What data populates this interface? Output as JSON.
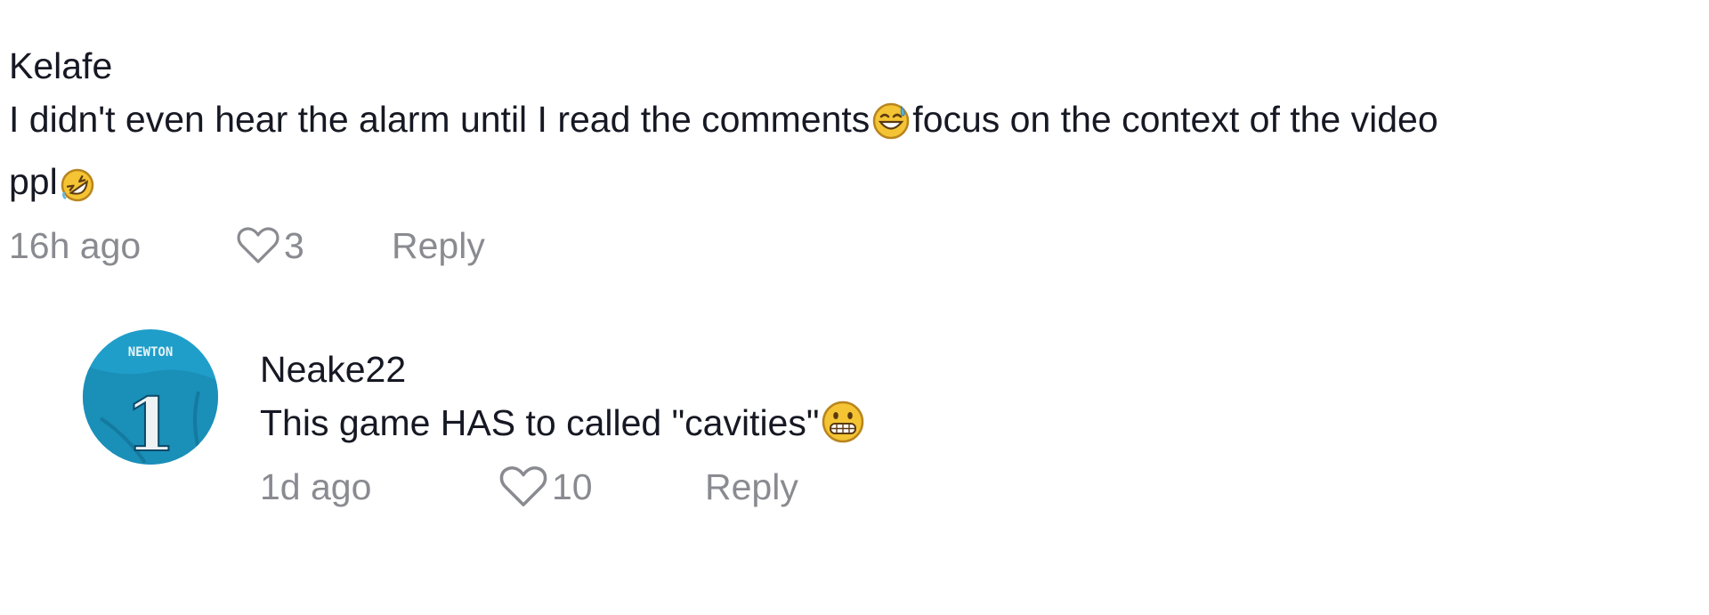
{
  "comments": [
    {
      "username": "Kelafe",
      "text_line1_part1": "I didn't even hear the alarm until I read the comments",
      "text_line1_part2": "focus on the context of the video",
      "text_line2": "ppl",
      "emojis": [
        "grinning-face-with-sweat-emoji",
        "rolling-on-floor-laughing-emoji"
      ],
      "time": "16h ago",
      "likes": "3",
      "reply_label": "Reply"
    },
    {
      "username": "Neake22",
      "text": "This game HAS to called \"cavities\"",
      "emojis": [
        "grimacing-face-emoji"
      ],
      "avatar_jersey_name": "NEWTON",
      "avatar_jersey_number": "1",
      "time": "1d ago",
      "likes": "10",
      "reply_label": "Reply"
    }
  ],
  "colors": {
    "text": "#161823",
    "meta": "#8a8b91",
    "avatar_teal": "#1f9ec9"
  },
  "icons": [
    "heart-outline-icon"
  ]
}
